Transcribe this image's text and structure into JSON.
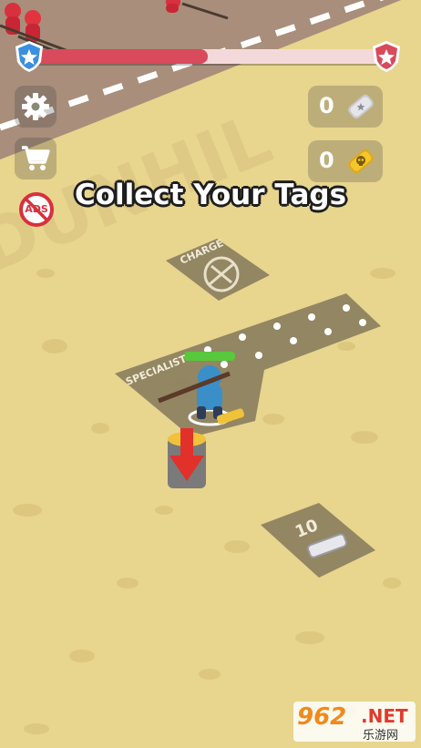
{
  "hud": {
    "progress": 0.5,
    "player_badge": "blue-star-shield-icon",
    "enemy_badge": "red-star-shield-icon",
    "accent_red": "#d94a5c",
    "accent_blue": "#3a8fe0"
  },
  "side_menu": {
    "settings_icon": "gear-icon",
    "shop_icon": "cart-icon",
    "no_ads_label": "ADS"
  },
  "counters": {
    "silver_tags": "0",
    "gold_tags": "0"
  },
  "tutorial": {
    "message": "Collect Your Tags"
  },
  "ground_zones": {
    "charge_label": "CHARGE",
    "specialist_label": "SPECIALIST",
    "tag_cost": "10"
  },
  "watermark": {
    "digits": "962",
    "suffix": ".NET",
    "cn": "乐游网"
  }
}
